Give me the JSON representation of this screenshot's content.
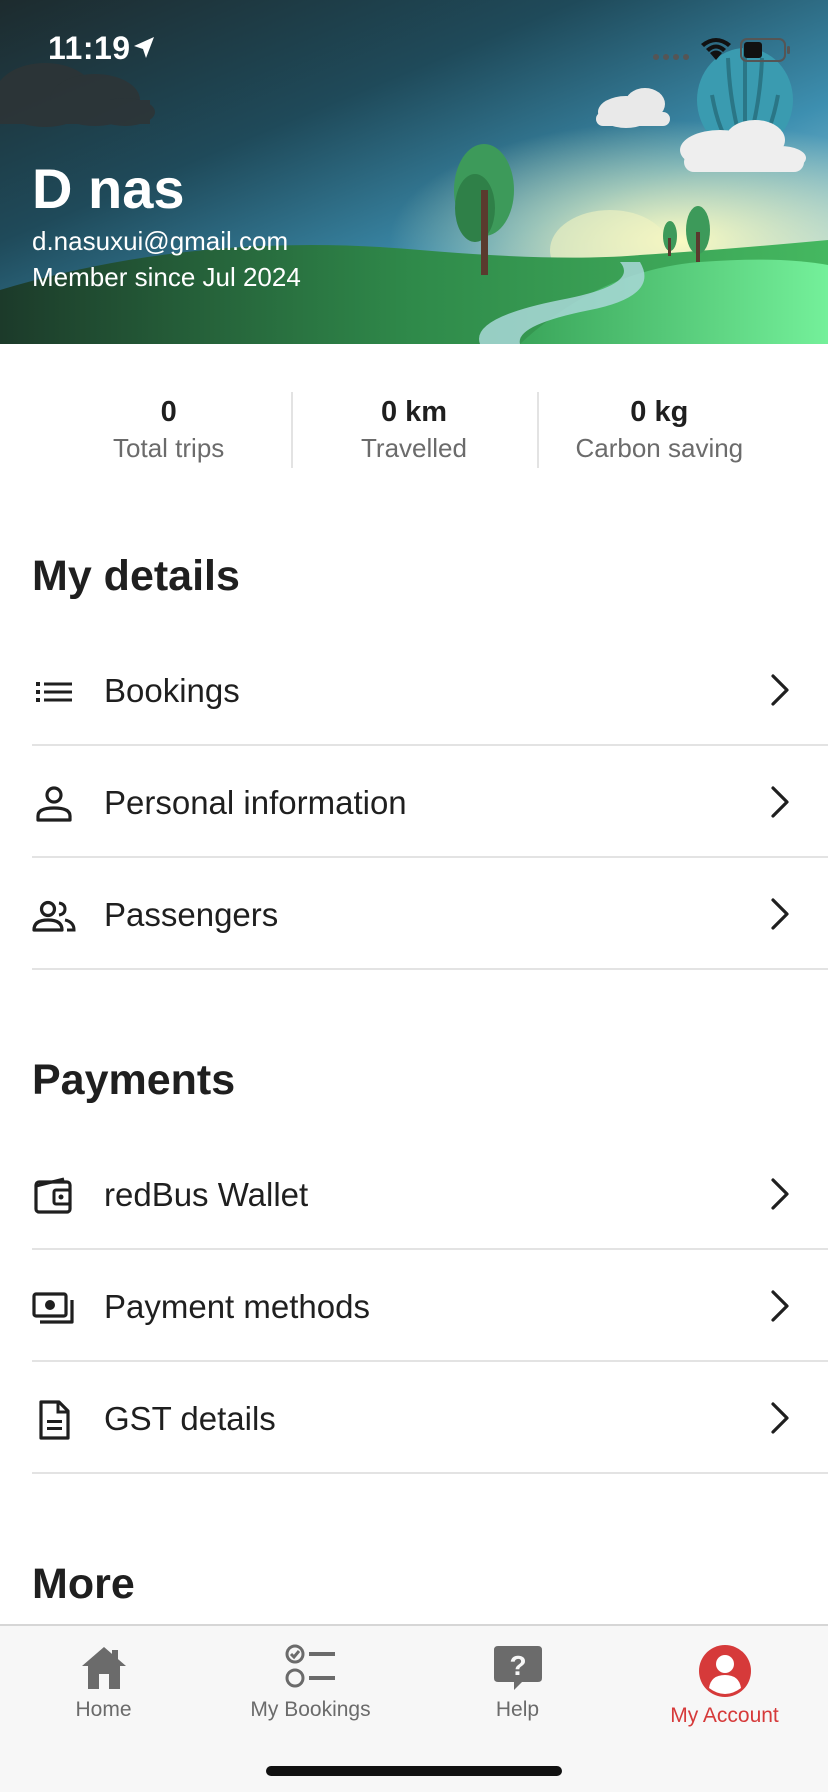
{
  "status_bar": {
    "time": "11:19",
    "icons": [
      "location-arrow-icon",
      "signal-icon",
      "wifi-icon",
      "battery-icon"
    ]
  },
  "profile": {
    "name": "D nas",
    "email": "d.nasuxui@gmail.com",
    "member_since": "Member since Jul 2024"
  },
  "stats": [
    {
      "value": "0",
      "label": "Total trips"
    },
    {
      "value": "0 km",
      "label": "Travelled"
    },
    {
      "value": "0 kg",
      "label": "Carbon saving"
    }
  ],
  "sections": {
    "my_details": {
      "title": "My details",
      "items": [
        {
          "label": "Bookings",
          "icon": "list-icon"
        },
        {
          "label": "Personal information",
          "icon": "person-icon"
        },
        {
          "label": "Passengers",
          "icon": "people-icon"
        }
      ]
    },
    "payments": {
      "title": "Payments",
      "items": [
        {
          "label": "redBus Wallet",
          "icon": "wallet-icon"
        },
        {
          "label": "Payment methods",
          "icon": "cash-icon"
        },
        {
          "label": "GST details",
          "icon": "document-icon"
        }
      ]
    },
    "more": {
      "title": "More"
    }
  },
  "tabbar": {
    "items": [
      {
        "label": "Home",
        "icon": "home-icon"
      },
      {
        "label": "My Bookings",
        "icon": "bookings-checklist-icon"
      },
      {
        "label": "Help",
        "icon": "help-icon"
      },
      {
        "label": "My Account",
        "icon": "account-icon"
      }
    ],
    "active_index": 3
  },
  "colors": {
    "accent": "#d63a3a",
    "text_primary": "#1f1f1f",
    "text_secondary": "#6b6b6b",
    "divider": "#e3e3e3"
  }
}
